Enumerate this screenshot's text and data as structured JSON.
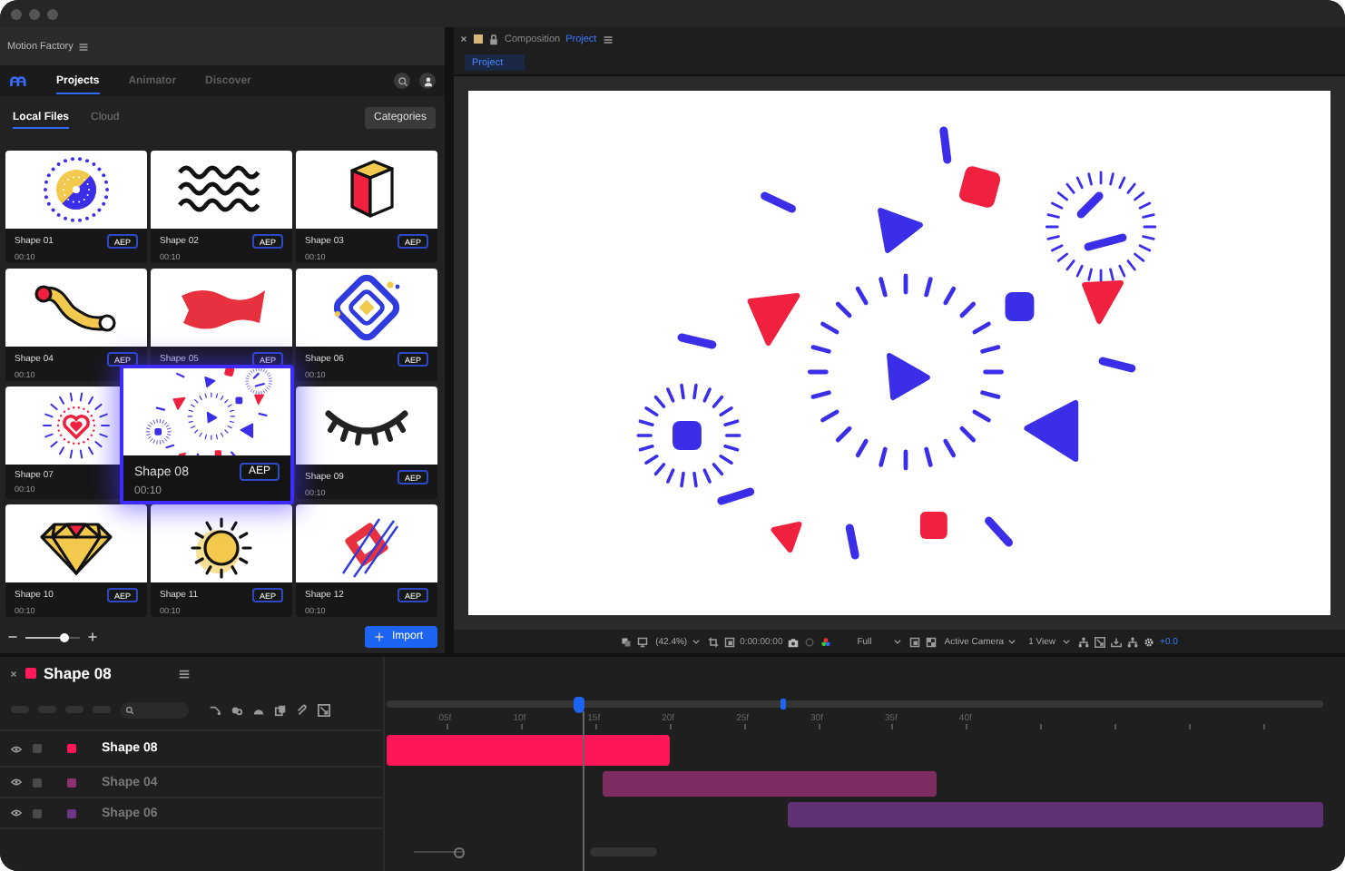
{
  "library": {
    "title": "Motion Factory",
    "tabs": [
      {
        "label": "Projects",
        "selected": true
      },
      {
        "label": "Animator",
        "selected": false
      },
      {
        "label": "Discover",
        "selected": false
      }
    ],
    "subtabs": [
      {
        "label": "Local Files",
        "selected": true
      },
      {
        "label": "Cloud",
        "selected": false
      }
    ],
    "categories_button": "Categories",
    "cards": [
      {
        "name": "Shape 01",
        "badge": "AEP",
        "duration": "00:10",
        "kind": "dotwheel",
        "hovered": false
      },
      {
        "name": "Shape 02",
        "badge": "AEP",
        "duration": "00:10",
        "kind": "waves",
        "hovered": false
      },
      {
        "name": "Shape 03",
        "badge": "AEP",
        "duration": "00:10",
        "kind": "cube",
        "hovered": false
      },
      {
        "name": "Shape 04",
        "badge": "AEP",
        "duration": "00:10",
        "kind": "worm",
        "hovered": false
      },
      {
        "name": "Shape 05",
        "badge": "AEP",
        "kind": "flag",
        "hovered": false
      },
      {
        "name": "Shape 06",
        "badge": "AEP",
        "duration": "00:10",
        "kind": "diamond",
        "hovered": false
      },
      {
        "name": "Shape 07",
        "duration": "00:10",
        "kind": "heart",
        "hovered": false
      },
      {
        "name": "Shape 08",
        "badge": "AEP",
        "duration": "00:10",
        "kind": "fireworks",
        "hovered": true
      },
      {
        "name": "Shape 09",
        "badge": "AEP",
        "duration": "00:10",
        "kind": "eye",
        "hovered": false
      },
      {
        "name": "Shape 10",
        "badge": "AEP",
        "duration": "00:10",
        "kind": "gem",
        "hovered": false
      },
      {
        "name": "Shape 11",
        "badge": "AEP",
        "duration": "00:10",
        "kind": "sun",
        "hovered": false
      },
      {
        "name": "Shape 12",
        "badge": "AEP",
        "duration": "00:10",
        "kind": "stripes",
        "hovered": false
      }
    ],
    "zoom": {
      "level": 0.72
    },
    "import_button": "Import"
  },
  "composition": {
    "label": "Composition",
    "name": "Project",
    "tabs": [
      {
        "label": "Project",
        "selected": true
      }
    ],
    "viewer_toolbar": {
      "magnification": "(42.4%)",
      "timecode": "0:00:00:00",
      "resolution": "Full",
      "camera": "Active Camera",
      "views": "1 View",
      "exposure": "+0.0"
    }
  },
  "timeline": {
    "title": "Shape 08",
    "color": "#ff1a5c",
    "work_area": {
      "level": 0.424
    },
    "playhead": {
      "level": 0.205
    },
    "ticks": [
      "05f",
      "10f",
      "15f",
      "20f",
      "25f",
      "30f",
      "35f",
      "40f"
    ],
    "layers": [
      {
        "name": "Shape 08",
        "color": "#ff1659",
        "selected": true
      },
      {
        "name": "Shape 04",
        "color": "#8f306e",
        "selected": false
      },
      {
        "name": "Shape 06",
        "color": "#6c3585",
        "selected": false
      }
    ],
    "zoom": {
      "level": 0.9
    }
  }
}
